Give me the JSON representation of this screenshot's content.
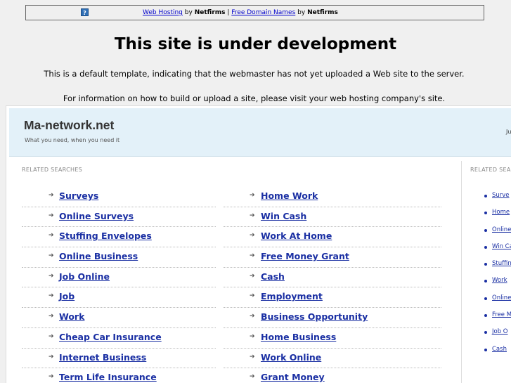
{
  "topbar": {
    "link1": "Web Hosting",
    "by1": "by",
    "brand1": "Netfirms",
    "sep": "|",
    "link2": "Free Domain Names",
    "by2": "by",
    "brand2": "Netfirms",
    "icon_glyph": "?"
  },
  "notice": {
    "title": "This site is under development",
    "line1": "This is a default template, indicating that the webmaster has not yet uploaded a Web site to the server.",
    "line2": "For information on how to build or upload a site, please visit your web hosting company's site."
  },
  "site": {
    "title": "Ma-network.net",
    "tagline": "What you need, when you need it",
    "header_right": "Ju"
  },
  "related": {
    "label": "RELATED SEARCHES",
    "label_right": "RELATED SEA",
    "left": [
      "Surveys",
      "Online Surveys",
      "Stuffing Envelopes",
      "Online Business",
      "Job Online",
      "Job",
      "Work",
      "Cheap Car Insurance",
      "Internet Business",
      "Term Life Insurance"
    ],
    "mid": [
      "Home Work",
      "Win Cash",
      "Work At Home",
      "Free Money Grant",
      "Cash",
      "Employment",
      "Business Opportunity",
      "Home Business",
      "Work Online",
      "Grant Money"
    ],
    "right": [
      "Surve",
      "Home",
      "Online",
      "Win Ca",
      "Stuffin",
      "Work",
      "Online",
      "Free M",
      "Job O",
      "Cash"
    ]
  }
}
